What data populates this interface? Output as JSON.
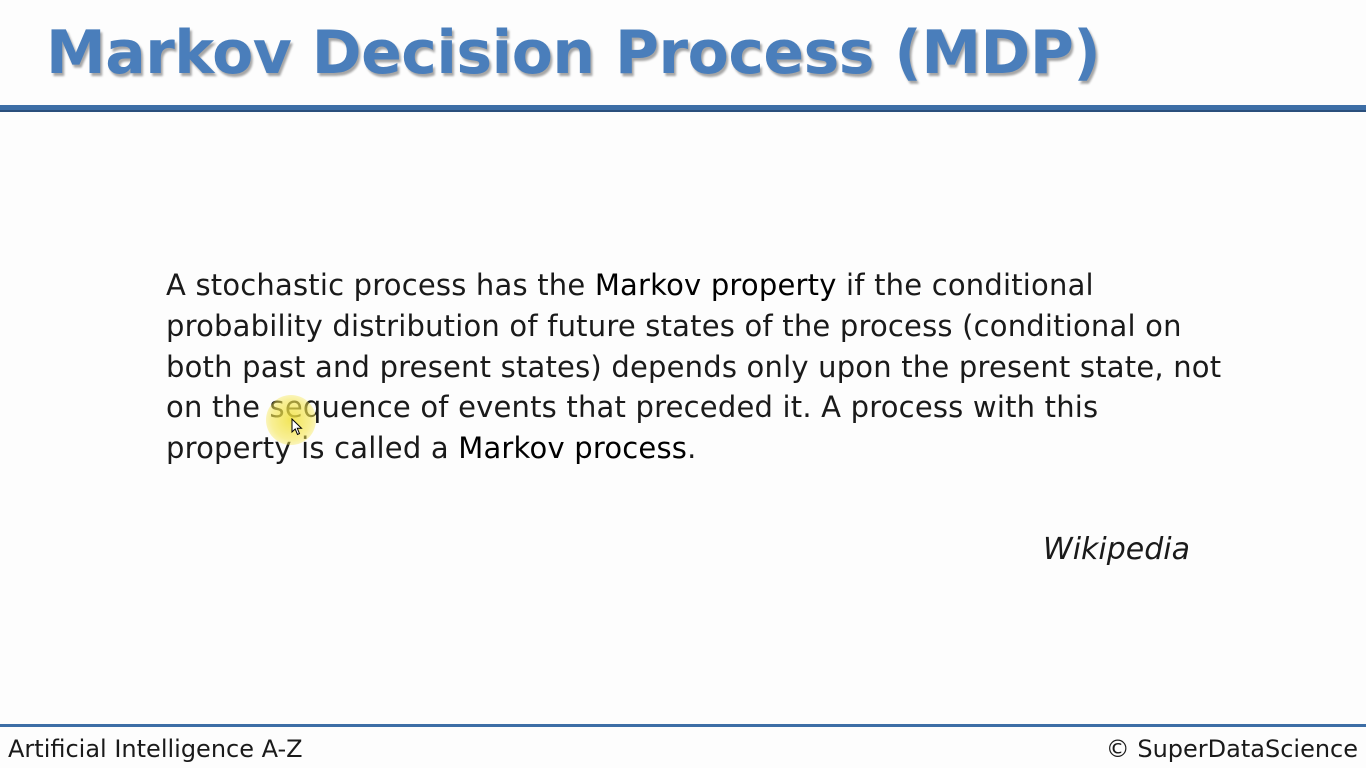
{
  "slide": {
    "title": "Markov Decision Process (MDP)",
    "body": {
      "segment_1": "A stochastic process has the ",
      "term_1": "Markov property",
      "segment_2": " if the conditional probability distribution of future states of the process (conditional on both past and present states) depends only upon the present state, not on the sequence of events that preceded it. A process with this property is called a ",
      "term_2": "Markov process",
      "segment_3": "."
    },
    "attribution": "Wikipedia"
  },
  "footer": {
    "course": "Artificial Intelligence A-Z",
    "copyright": "© SuperDataScience"
  },
  "colors": {
    "title": "#4a7ebb",
    "rule": "#3d6ea6",
    "cursor_highlight": "#f0e13c"
  },
  "icons": {
    "cursor": "mouse-pointer-icon"
  }
}
